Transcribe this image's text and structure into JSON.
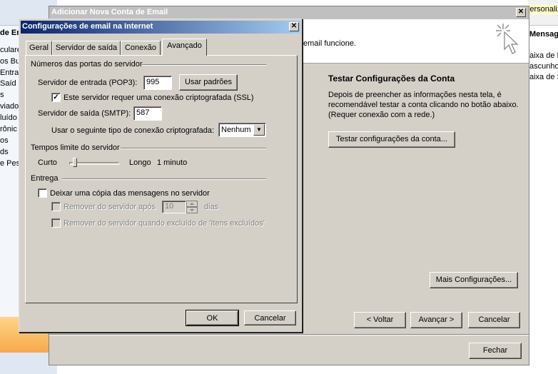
{
  "background": {
    "left_pane_header": "de En",
    "left_pane_items": [
      "culares",
      "os Bu",
      "Entra",
      "Saíd",
      "s",
      "viado",
      "luído",
      "rônic",
      "os",
      "ds",
      "e Pes"
    ],
    "right_header": "Mensag",
    "right_items": [
      "aixa de E",
      "ascunho",
      "aixa de S"
    ],
    "personal_tab": "Personaliz"
  },
  "account_window": {
    "title": "Adicionar Nova Conta de Email",
    "header_text": "email funcione.",
    "test_title": "Testar Configurações da Conta",
    "test_description": "Depois de preencher as informações nesta tela, é recomendável testar a conta clicando no botão abaixo. (Requer conexão com a rede.)",
    "test_button": "Testar configurações da conta...",
    "more_settings_button": "Mais Configurações...",
    "back_button": "< Voltar",
    "next_button": "Avançar >",
    "cancel_button": "Cancelar",
    "close_button": "Fechar"
  },
  "dialog": {
    "title": "Configurações de email na Internet",
    "tabs": [
      "Geral",
      "Servidor de saída",
      "Conexão",
      "Avançado"
    ],
    "active_tab": "Avançado",
    "ports_group": "Números das portas do servidor",
    "incoming_label": "Servidor de entrada (POP3):",
    "incoming_value": "995",
    "use_defaults_button": "Usar padrões",
    "ssl_checkbox_label": "Este servidor requer uma conexão criptografada (SSL)",
    "ssl_checked": true,
    "outgoing_label": "Servidor de saída (SMTP):",
    "outgoing_value": "587",
    "encryption_label": "Usar o seguinte tipo de conexão criptografada:",
    "encryption_value": "Nenhum",
    "timeouts_group": "Tempos limite do servidor",
    "timeout_short": "Curto",
    "timeout_long": "Longo",
    "timeout_value": "1 minuto",
    "timeout_fraction": 0.05,
    "delivery_group": "Entrega",
    "leave_copy_label": "Deixar uma cópia das mensagens no servidor",
    "leave_copy_checked": false,
    "remove_after_label": "Remover do servidor após",
    "remove_after_days": "10",
    "days_label": "dias",
    "remove_deleted_label": "Remover do servidor quando excluído de 'Itens excluídos'",
    "ok_button": "OK",
    "cancel_button": "Cancelar"
  }
}
